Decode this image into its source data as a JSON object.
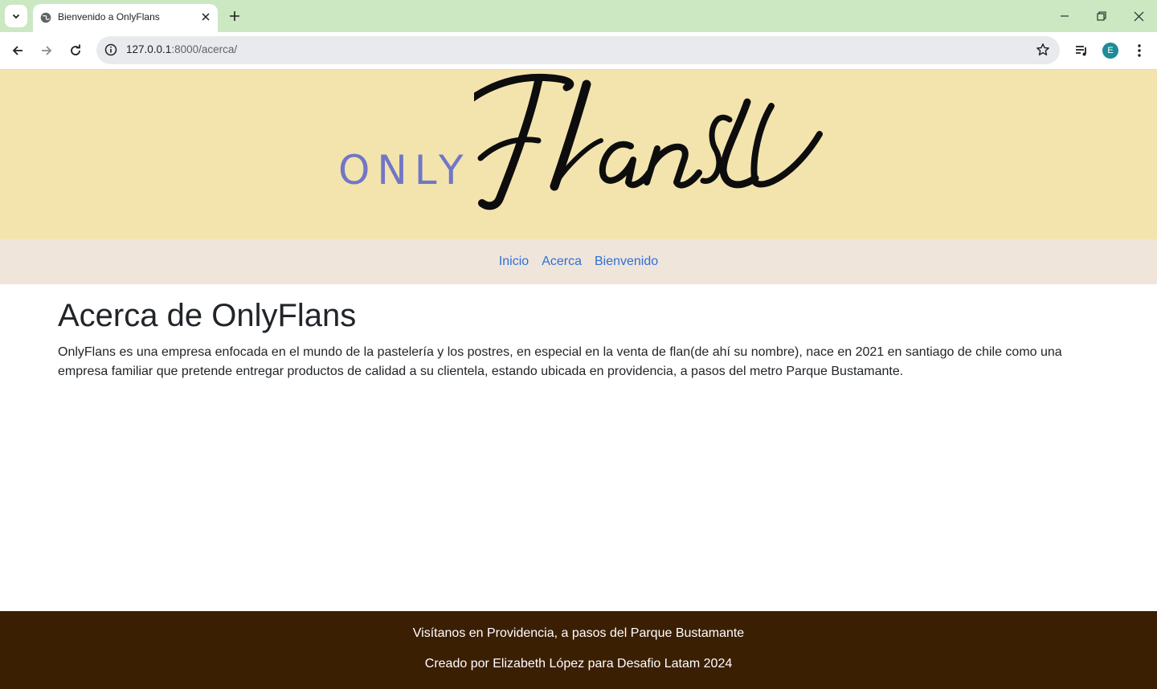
{
  "browser": {
    "tab_title": "Bienvenido a OnlyFlans",
    "url_host": "127.0.0.1",
    "url_rest": ":8000/acerca/",
    "profile_initial": "E"
  },
  "header": {
    "logo_only": "ONLY",
    "logo_flans": "Flans"
  },
  "nav": {
    "items": [
      {
        "label": "Inicio"
      },
      {
        "label": "Acerca"
      },
      {
        "label": "Bienvenido"
      }
    ]
  },
  "main": {
    "title": "Acerca de OnlyFlans",
    "text": "OnlyFlans es una empresa enfocada en el mundo de la pastelería y los postres, en especial en la venta de flan(de ahí su nombre), nace en 2021 en santiago de chile como una empresa familiar que pretende entregar productos de calidad a su clientela, estando ubicada en providencia, a pasos del metro Parque Bustamante."
  },
  "footer": {
    "line1": "Visítanos en Providencia, a pasos del Parque Bustamante",
    "line2": "Creado por Elizabeth López para Desafio Latam 2024"
  },
  "colors": {
    "tabstrip": "#cbe8c3",
    "hero": "#f3e4ae",
    "nav_bg": "#efe5da",
    "link": "#2f70d6",
    "footer": "#3b1f03",
    "logo_only": "#7276c6"
  }
}
